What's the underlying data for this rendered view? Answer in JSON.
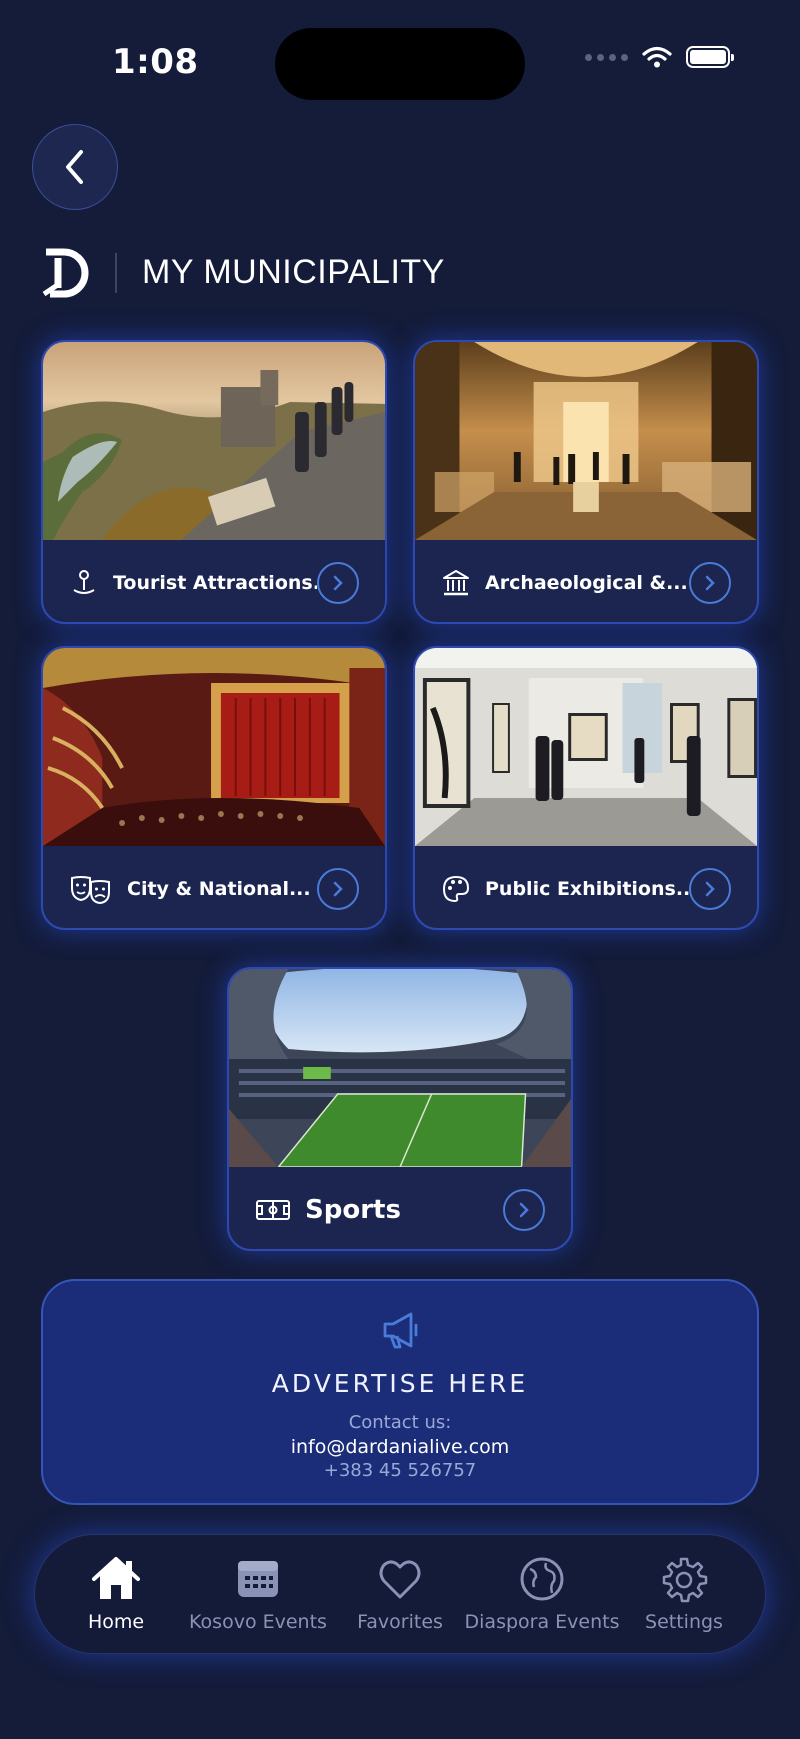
{
  "status": {
    "time": "1:08"
  },
  "header": {
    "title": "MY MUNICIPALITY"
  },
  "cards": [
    {
      "label": "Tourist Attractions...",
      "icon": "map-pin-icon"
    },
    {
      "label": "Archaeological &...",
      "icon": "museum-icon"
    },
    {
      "label": "City & National...",
      "icon": "theater-masks-icon"
    },
    {
      "label": "Public Exhibitions...",
      "icon": "palette-icon"
    },
    {
      "label": "Sports",
      "icon": "stadium-field-icon"
    }
  ],
  "advert": {
    "title": "ADVERTISE HERE",
    "contact_label": "Contact us:",
    "email": "info@dardanialive.com",
    "phone": "+383 45 526757"
  },
  "tabs": [
    {
      "label": "Home",
      "icon": "home-icon",
      "active": true
    },
    {
      "label": "Kosovo Events",
      "icon": "calendar-icon",
      "active": false
    },
    {
      "label": "Favorites",
      "icon": "heart-icon",
      "active": false
    },
    {
      "label": "Diaspora Events",
      "icon": "globe-icon",
      "active": false
    },
    {
      "label": "Settings",
      "icon": "gear-icon",
      "active": false
    }
  ],
  "colors": {
    "background": "#141c3a",
    "accent": "#4a7bd8",
    "card": "#1b2550",
    "advert": "#1b2d78"
  }
}
